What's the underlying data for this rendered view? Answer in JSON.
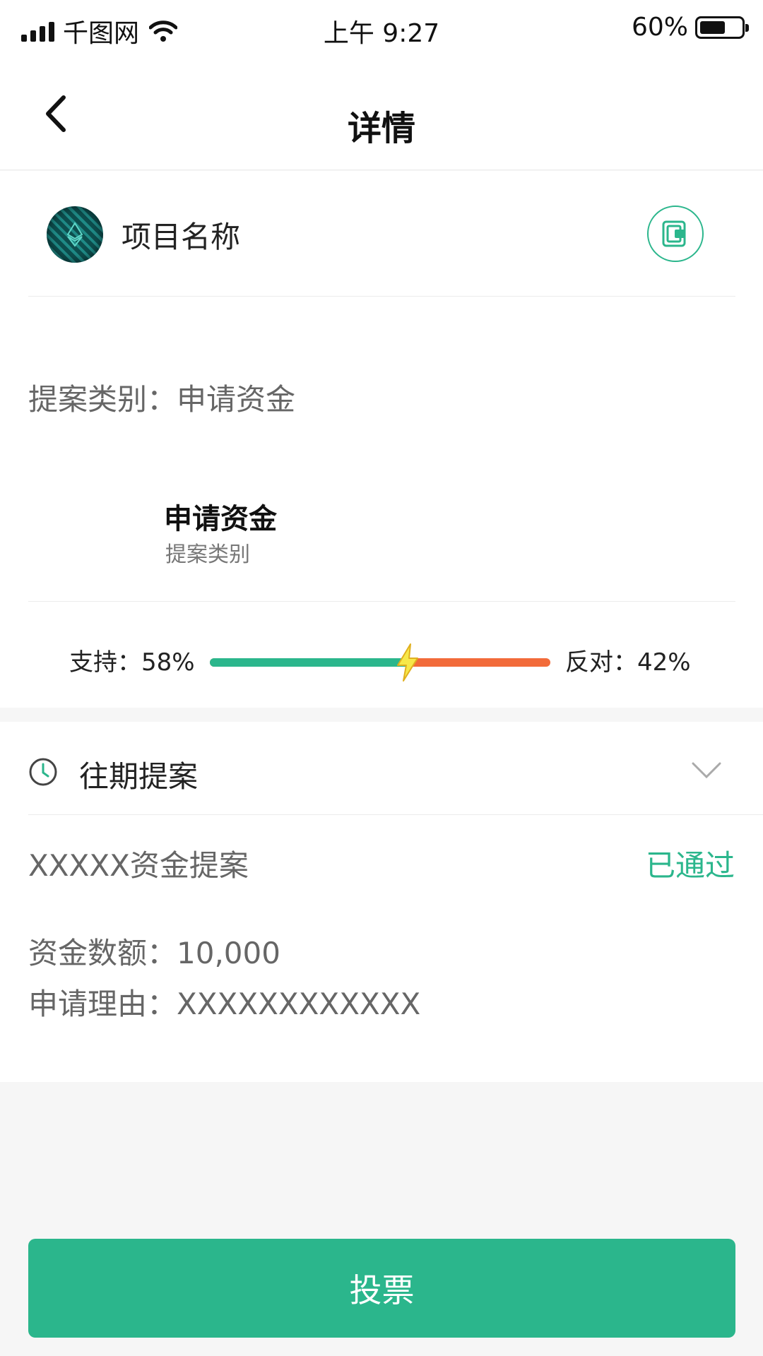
{
  "status_bar": {
    "carrier": "千图网",
    "time": "上午 9:27",
    "battery": "60%",
    "battery_level": 0.6,
    "icons": [
      "signal-icon",
      "wifi-icon",
      "battery-icon"
    ]
  },
  "nav": {
    "title": "详情",
    "back_icon": "chevron-left-icon"
  },
  "project": {
    "name": "项目名称",
    "badge_icon": "document-badge-icon"
  },
  "proposal": {
    "type_line_label": "提案类别：",
    "type_line_value": "申请资金",
    "bold_title": "申请资金",
    "sub_label": "提案类别"
  },
  "vote": {
    "support_label": "支持：58%",
    "oppose_label": "反对：42%",
    "support_fraction": 0.58,
    "colors": {
      "support": "#2bb68c",
      "oppose": "#f26b3a"
    }
  },
  "history": {
    "title": "往期提案",
    "item_title": "XXXXX资金提案",
    "item_status": "已通过",
    "amount_label": "资金数额：",
    "amount_value": "10,000",
    "reason_label": "申请理由：",
    "reason_value": "XXXXXXXXXXXX"
  },
  "actions": {
    "vote_button": "投票"
  },
  "colors": {
    "accent": "#2bb68c",
    "background": "#f6f6f6"
  }
}
